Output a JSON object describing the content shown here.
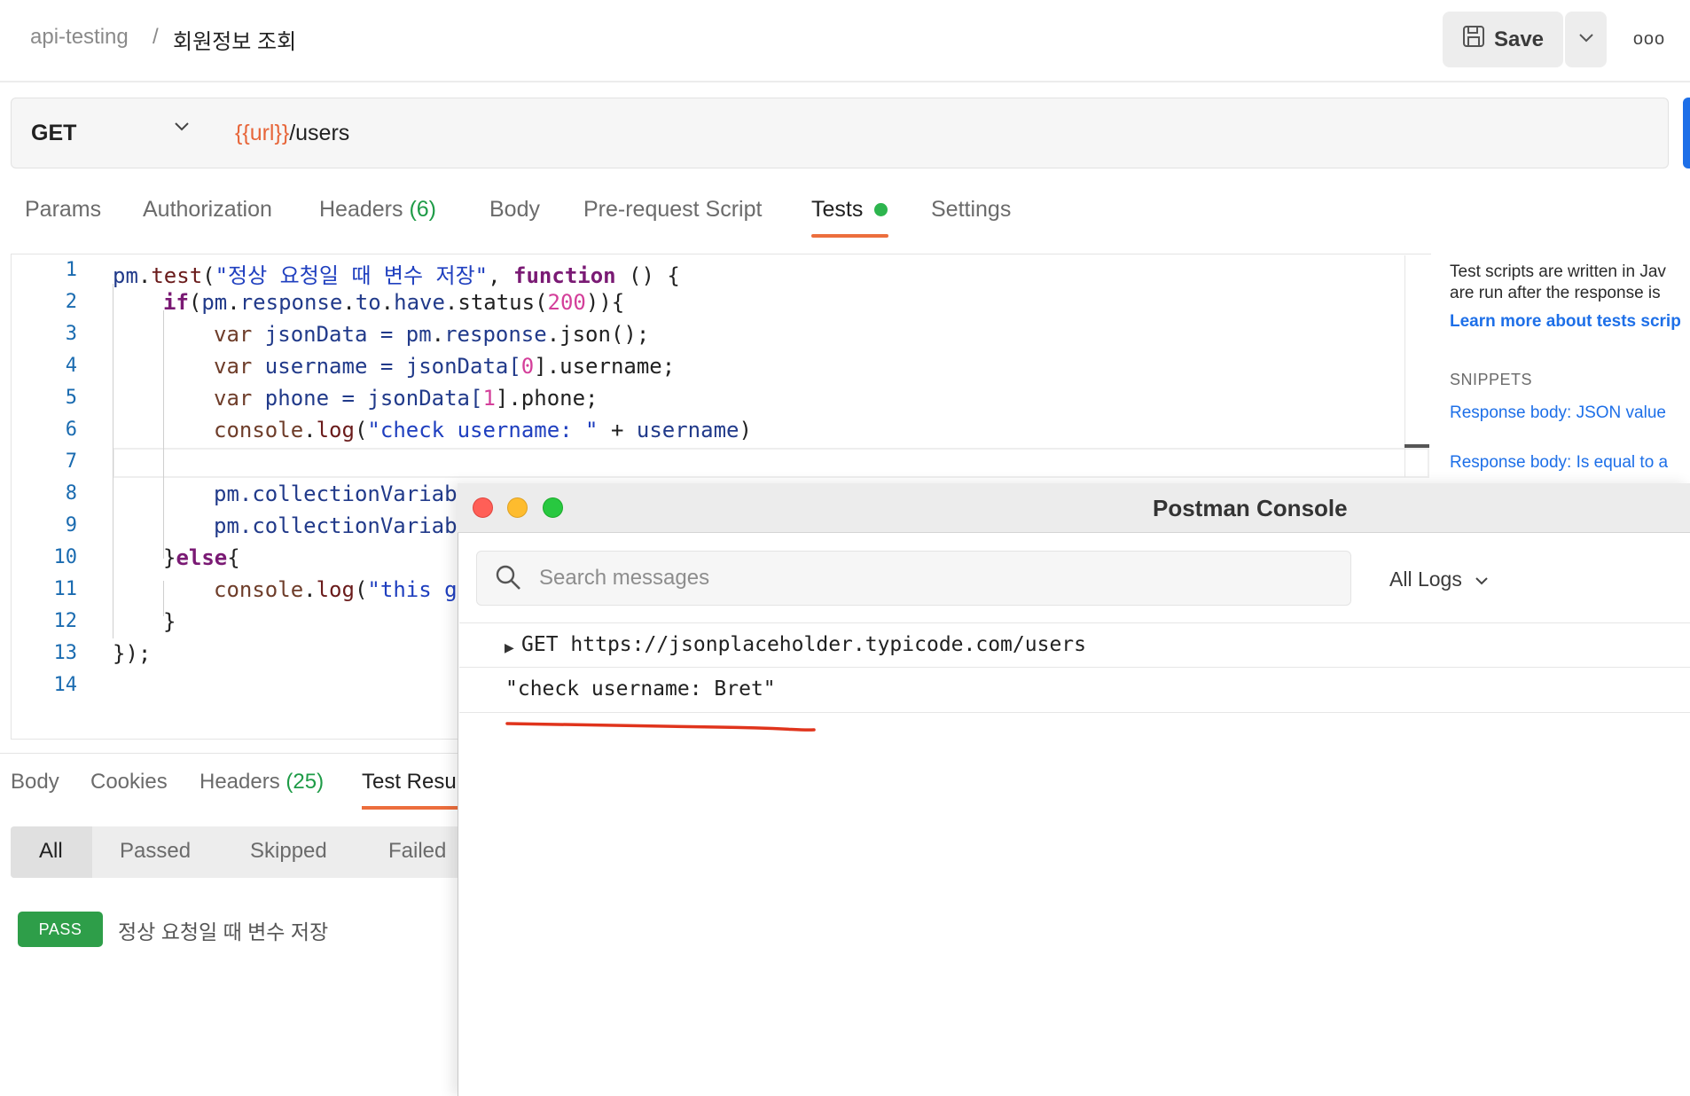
{
  "header": {
    "collection": "api-testing",
    "separator": "/",
    "request_name": "회원정보 조회",
    "save_label": "Save",
    "more_label": "ooo"
  },
  "request": {
    "method": "GET",
    "url_variable": "{{url}}",
    "url_path": "/users"
  },
  "request_tabs": {
    "params": "Params",
    "authorization": "Authorization",
    "headers": "Headers",
    "headers_count": "(6)",
    "body": "Body",
    "prerequest": "Pre-request Script",
    "tests": "Tests",
    "settings": "Settings",
    "active": "Tests"
  },
  "editor": {
    "line_numbers": [
      "1",
      "2",
      "3",
      "4",
      "5",
      "6",
      "7",
      "8",
      "9",
      "10",
      "11",
      "12",
      "13",
      "14"
    ],
    "l1": {
      "a": "pm",
      "b": ".",
      "c": "test",
      "d": "(",
      "e": "\"정상 요청일 때 변수 저장\"",
      "f": ", ",
      "g": "function",
      "h": " () {"
    },
    "l2": {
      "a": "if",
      "b": "(",
      "c": "pm",
      "d": ".",
      "e": "response",
      "f": ".",
      "g": "to",
      "h": ".",
      "i": "have",
      "j": ".status(",
      "k": "200",
      "l": ")){"
    },
    "l3": {
      "a": "var",
      "b": " jsonData = ",
      "c": "pm",
      "d": ".",
      "e": "response",
      "f": ".json();"
    },
    "l4": {
      "a": "var",
      "b": " username = ",
      "c": "jsonData[",
      "d": "0",
      "e": "].username;"
    },
    "l5": {
      "a": "var",
      "b": " phone = ",
      "c": "jsonData[",
      "d": "1",
      "e": "].phone;"
    },
    "l6": {
      "a": "console",
      "b": ".",
      "c": "log",
      "d": "(",
      "e": "\"check username: \"",
      "f": " + ",
      "g": "username",
      "h": ")"
    },
    "l8": {
      "a": "pm",
      "b": ".collectionVariab"
    },
    "l9": {
      "a": "pm",
      "b": ".collectionVariab"
    },
    "l10": {
      "a": "}",
      "b": "else",
      "c": "{"
    },
    "l11": {
      "a": "console",
      "b": ".",
      "c": "log",
      "d": "(",
      "e": "\"this g"
    },
    "l12": {
      "a": "}"
    },
    "l13": {
      "a": "});"
    }
  },
  "help_panel": {
    "line1": "Test scripts are written in Jav",
    "line2": "are run after the response is",
    "learn_more": "Learn more about tests scrip",
    "snippets_heading": "SNIPPETS",
    "snippet1": "Response body: JSON value",
    "snippet2": "Response body: Is equal to a"
  },
  "response_tabs": {
    "body": "Body",
    "cookies": "Cookies",
    "headers": "Headers",
    "headers_count": "(25)",
    "test_results": "Test Resu"
  },
  "test_filters": {
    "all": "All",
    "passed": "Passed",
    "skipped": "Skipped",
    "failed": "Failed",
    "active": "All"
  },
  "test_results": [
    {
      "status": "PASS",
      "name": "정상 요청일 때 변수 저장"
    }
  ],
  "console": {
    "title": "Postman Console",
    "search_placeholder": "Search messages",
    "log_filter": "All Logs",
    "entries": [
      {
        "method": "GET",
        "url": "https://jsonplaceholder.typicode.com/users"
      },
      {
        "text": "\"check username: Bret\""
      }
    ]
  },
  "colors": {
    "accent": "#ec6e3d",
    "pass_green": "#2e9e49",
    "send_blue": "#1d6fe8",
    "annotation_red": "#e0341c",
    "traffic_red": "#ff5f57",
    "traffic_yellow": "#febc2e",
    "traffic_green": "#28c840"
  }
}
